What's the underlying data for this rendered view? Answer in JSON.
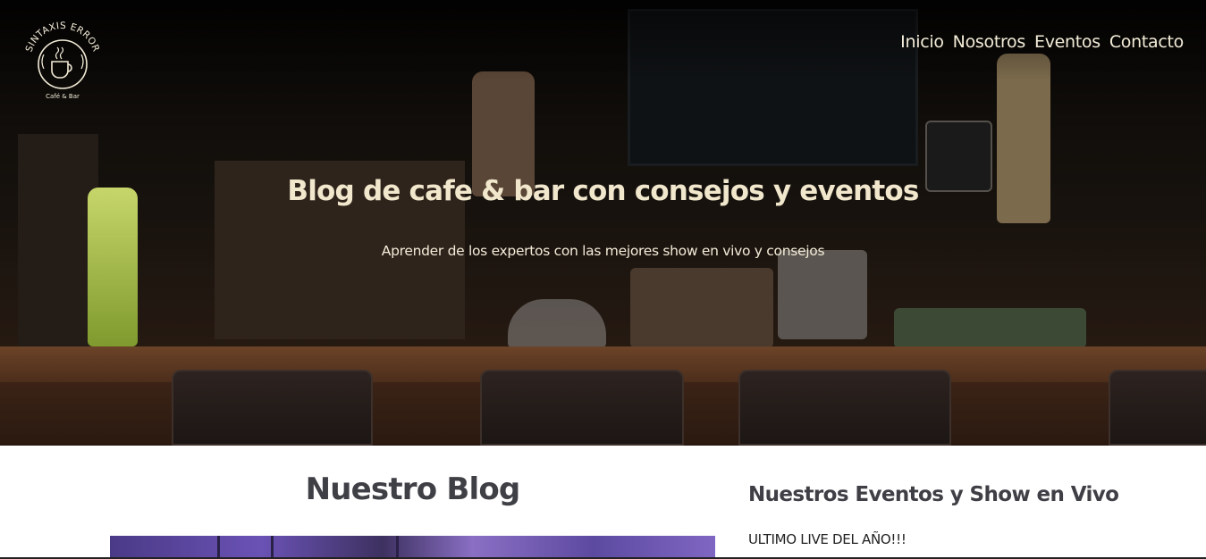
{
  "brand": {
    "name": "SINTAXIS ERROR",
    "tagline": "Café & Bar"
  },
  "nav": {
    "items": [
      {
        "label": "Inicio"
      },
      {
        "label": "Nosotros"
      },
      {
        "label": "Eventos"
      },
      {
        "label": "Contacto"
      }
    ]
  },
  "hero": {
    "title": "Blog de cafe & bar con consejos y eventos",
    "subtitle": "Aprender de los expertos con las mejores show en vivo y consejos"
  },
  "blog": {
    "title": "Nuestro Blog"
  },
  "events": {
    "title": "Nuestros Eventos y Show en Vivo",
    "items": [
      {
        "title": "ULTIMO LIVE DEL AÑO!!!"
      }
    ]
  },
  "colors": {
    "hero_text": "#f1e7cc",
    "heading": "#3f3f46",
    "body_text": "#222222"
  },
  "icons": {
    "logo": "coffee-cup-icon"
  }
}
